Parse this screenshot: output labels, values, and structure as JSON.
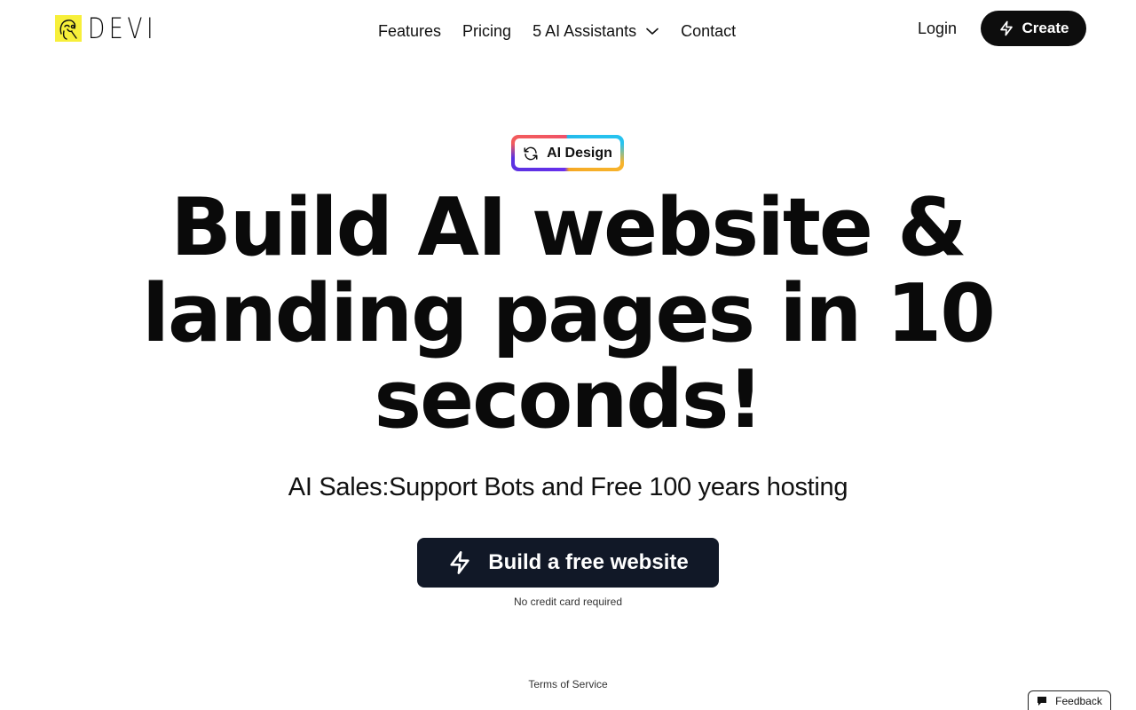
{
  "header": {
    "logo_text": "DEVI",
    "nav": {
      "features": "Features",
      "pricing": "Pricing",
      "assistants": "5 AI Assistants",
      "contact": "Contact"
    },
    "login_label": "Login",
    "create_label": "Create"
  },
  "badge": {
    "label": "AI Design"
  },
  "hero": {
    "title": "Build AI website & landing pages in 10 seconds!",
    "subtitle": "AI Sales:Support Bots and Free 100 years hosting",
    "cta_label": "Build a free website",
    "cta_note": "No credit card required"
  },
  "footer": {
    "terms_label": "Terms of Service"
  },
  "feedback": {
    "label": "Feedback"
  },
  "colors": {
    "logo_background": "#f7ef3a",
    "primary_button": "#0d0d0d",
    "cta_background": "#111827"
  },
  "icons": [
    "logo-face-icon",
    "chevron-down-icon",
    "bolt-icon",
    "refresh-icon",
    "chat-bubble-icon"
  ]
}
